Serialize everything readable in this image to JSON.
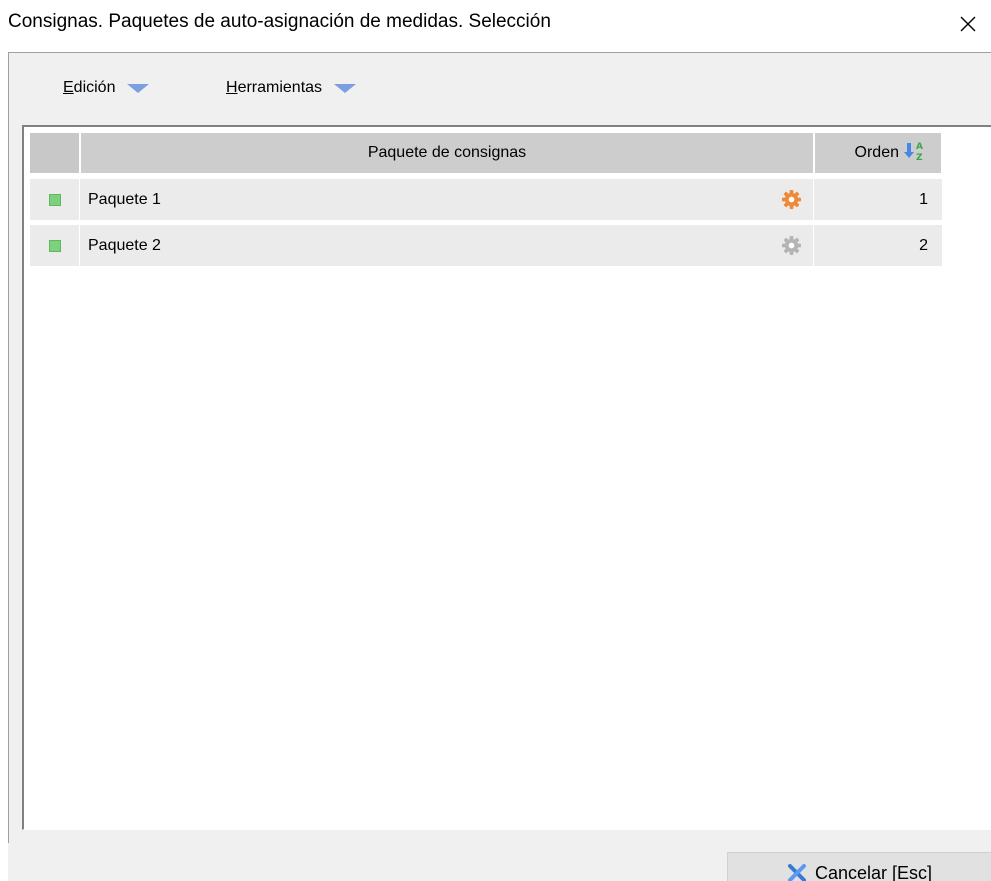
{
  "window": {
    "title": "Consignas. Paquetes de auto-asignación de medidas. Selección",
    "close_icon": "close-icon"
  },
  "menubar": {
    "items": [
      {
        "label_underlined": "E",
        "label_rest": "dición",
        "icon": "chevron-down-icon"
      },
      {
        "label_underlined": "H",
        "label_rest": "erramientas",
        "icon": "chevron-down-icon"
      }
    ]
  },
  "grid": {
    "columns": [
      {
        "label": ""
      },
      {
        "label": "Paquete de consignas"
      },
      {
        "label": "Orden",
        "icon": "sort-ascending-az-icon"
      }
    ],
    "rows": [
      {
        "selector_icon": "green-square-icon",
        "name": "Paquete 1",
        "gear_icon": "gear-active-icon",
        "gear_color": "#f0883a",
        "orden": "1"
      },
      {
        "selector_icon": "green-square-icon",
        "name": "Paquete 2",
        "gear_icon": "gear-inactive-icon",
        "gear_color": "#b4b4b4",
        "orden": "2"
      }
    ]
  },
  "footer": {
    "cancel_label": "Cancelar  [Esc]",
    "cancel_icon": "blue-x-icon"
  },
  "colors": {
    "accent_arrow": "#7b9fe0",
    "header_bg": "#cdcdcd",
    "row_bg": "#ebebeb",
    "selector_green": "#7ed07e"
  }
}
